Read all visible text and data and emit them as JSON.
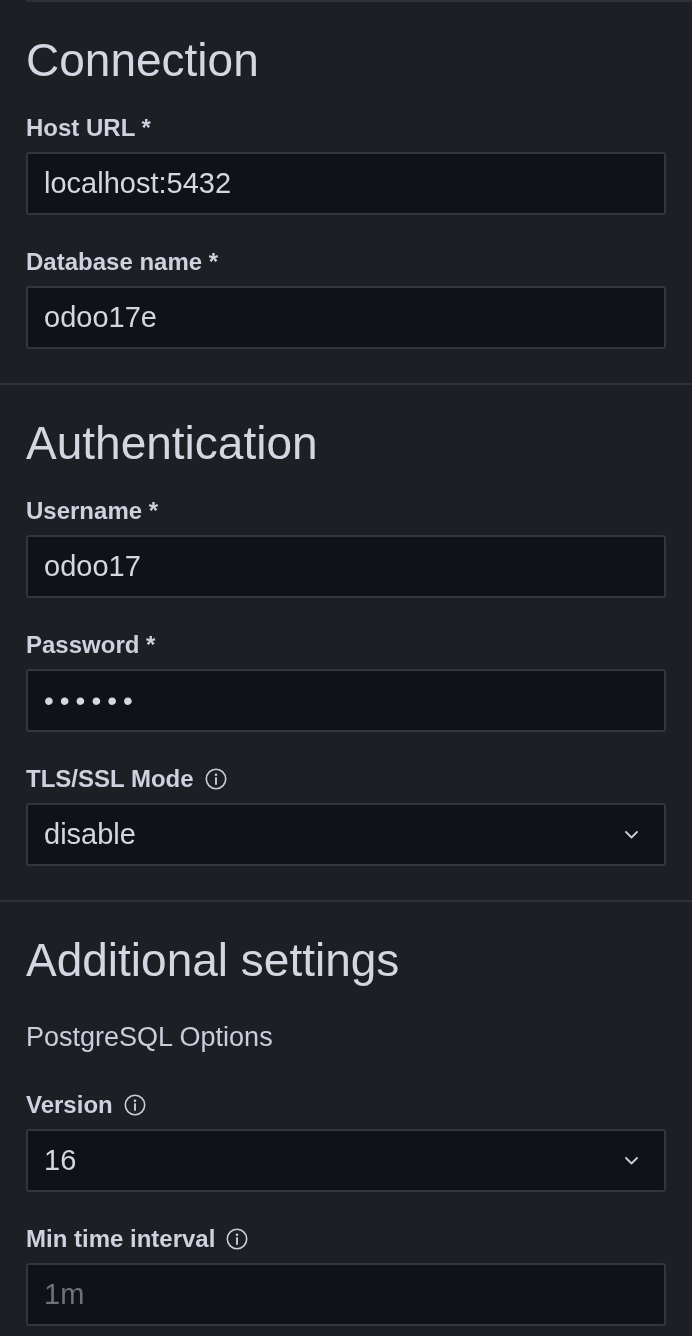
{
  "sections": [
    {
      "title": "Connection",
      "fields": [
        {
          "kind": "text",
          "label": "Host URL *",
          "info": false,
          "value": "localhost:5432"
        },
        {
          "kind": "text",
          "label": "Database name *",
          "info": false,
          "value": "odoo17e"
        }
      ]
    },
    {
      "title": "Authentication",
      "fields": [
        {
          "kind": "text",
          "label": "Username *",
          "info": false,
          "value": "odoo17"
        },
        {
          "kind": "password",
          "label": "Password *",
          "info": false,
          "value": "••••••"
        },
        {
          "kind": "select",
          "label": "TLS/SSL Mode",
          "info": true,
          "value": "disable"
        }
      ]
    },
    {
      "title": "Additional settings",
      "subtitle": "PostgreSQL Options",
      "fields": [
        {
          "kind": "select",
          "label": "Version",
          "info": true,
          "value": "16"
        },
        {
          "kind": "text",
          "label": "Min time interval",
          "info": true,
          "placeholder": "1m"
        }
      ]
    }
  ]
}
